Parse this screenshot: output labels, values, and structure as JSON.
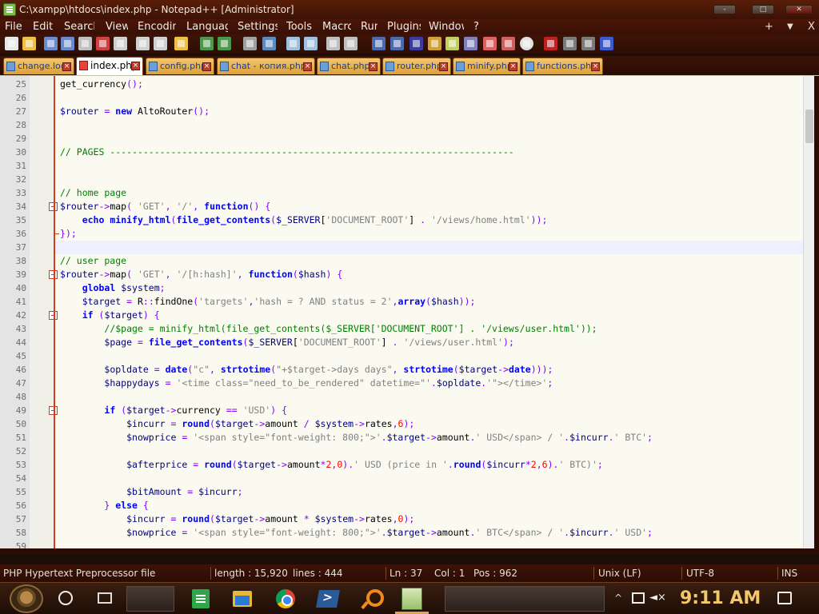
{
  "window": {
    "title": "C:\\xampp\\htdocs\\index.php - Notepad++ [Administrator]",
    "min": "-",
    "max": "□",
    "close": "✕"
  },
  "menu": {
    "items": [
      "File",
      "Edit",
      "Search",
      "View",
      "Encoding",
      "Language",
      "Settings",
      "Tools",
      "Macro",
      "Run",
      "Plugins",
      "Window",
      "?"
    ],
    "add_label": "+",
    "dropdown_label": "▼",
    "close_label": "X"
  },
  "tabs": [
    {
      "label": "change.log",
      "active": false
    },
    {
      "label": "index.php",
      "active": true
    },
    {
      "label": "config.php",
      "active": false
    },
    {
      "label": "chat - копия.php",
      "active": false
    },
    {
      "label": "chat.php",
      "active": false
    },
    {
      "label": "router.php",
      "active": false
    },
    {
      "label": "minify.php",
      "active": false
    },
    {
      "label": "functions.php",
      "active": false
    }
  ],
  "editor": {
    "current_line": 37,
    "lines": [
      {
        "n": 25,
        "text": "get_currency();"
      },
      {
        "n": 26,
        "text": ""
      },
      {
        "n": 27,
        "text": "$router = new AltoRouter();"
      },
      {
        "n": 28,
        "text": ""
      },
      {
        "n": 29,
        "text": ""
      },
      {
        "n": 30,
        "text": "// PAGES -------------------------------------------------------------------------"
      },
      {
        "n": 31,
        "text": ""
      },
      {
        "n": 32,
        "text": ""
      },
      {
        "n": 33,
        "text": "// home page"
      },
      {
        "n": 34,
        "text": "$router->map( 'GET', '/', function() {"
      },
      {
        "n": 35,
        "text": "    echo minify_html(file_get_contents($_SERVER['DOCUMENT_ROOT'] . '/views/home.html'));"
      },
      {
        "n": 36,
        "text": "});"
      },
      {
        "n": 37,
        "text": ""
      },
      {
        "n": 38,
        "text": "// user page"
      },
      {
        "n": 39,
        "text": "$router->map( 'GET', '/[h:hash]', function($hash) {"
      },
      {
        "n": 40,
        "text": "    global $system;"
      },
      {
        "n": 41,
        "text": "    $target = R::findOne('targets','hash = ? AND status = 2',array($hash));"
      },
      {
        "n": 42,
        "text": "    if ($target) {"
      },
      {
        "n": 43,
        "text": "        //$page = minify_html(file_get_contents($_SERVER['DOCUMENT_ROOT'] . '/views/user.html'));"
      },
      {
        "n": 44,
        "text": "        $page = file_get_contents($_SERVER['DOCUMENT_ROOT'] . '/views/user.html');"
      },
      {
        "n": 45,
        "text": ""
      },
      {
        "n": 46,
        "text": "        $opldate = date(\"c\", strtotime(\"+$target->days days\", strtotime($target->date)));"
      },
      {
        "n": 47,
        "text": "        $happydays = '<time class=\"need_to_be_rendered\" datetime=\"'.$opldate.'\"></time>';"
      },
      {
        "n": 48,
        "text": ""
      },
      {
        "n": 49,
        "text": "        if ($target->currency == 'USD') {"
      },
      {
        "n": 50,
        "text": "            $incurr = round($target->amount / $system->rates,6);"
      },
      {
        "n": 51,
        "text": "            $nowprice = '<span style=\"font-weight: 800;\">'.$target->amount.' USD</span> / '.$incurr.' BTC';"
      },
      {
        "n": 52,
        "text": ""
      },
      {
        "n": 53,
        "text": "            $afterprice = round($target->amount*2,0).' USD (price in '.round($incurr*2,6).' BTC)';"
      },
      {
        "n": 54,
        "text": ""
      },
      {
        "n": 55,
        "text": "            $bitAmount = $incurr;"
      },
      {
        "n": 56,
        "text": "        } else {"
      },
      {
        "n": 57,
        "text": "            $incurr = round($target->amount * $system->rates,0);"
      },
      {
        "n": 58,
        "text": "            $nowprice = '<span style=\"font-weight: 800;\">'.$target->amount.' BTC</span> / '.$incurr.' USD';"
      },
      {
        "n": 59,
        "text": ""
      }
    ]
  },
  "status": {
    "file_type": "PHP Hypertext Preprocessor file",
    "length": "length : 15,920",
    "lines": "lines : 444",
    "ln": "Ln : 37",
    "col": "Col : 1",
    "pos": "Pos : 962",
    "eol": "Unix (LF)",
    "encoding": "UTF-8",
    "mode": "INS"
  },
  "taskbar": {
    "clock": "9:11 AM"
  }
}
